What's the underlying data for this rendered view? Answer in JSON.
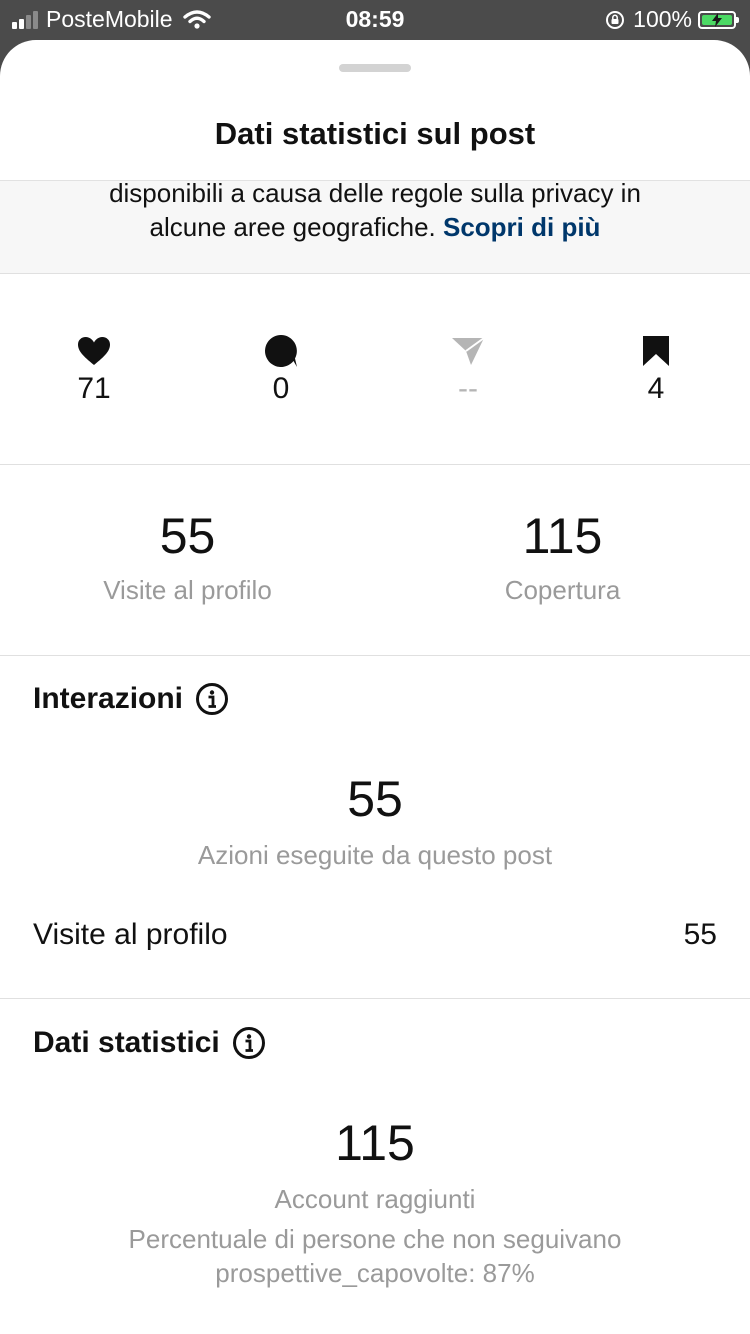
{
  "status_bar": {
    "carrier": "PosteMobile",
    "time": "08:59",
    "battery": "100%"
  },
  "sheet": {
    "title": "Dati statistici sul post",
    "privacy_line1": "disponibili a causa delle regole sulla privacy in",
    "privacy_line2": "alcune aree geografiche.",
    "privacy_link": "Scopri di più"
  },
  "engagement": {
    "likes": "71",
    "comments": "0",
    "shares": "--",
    "saves": "4",
    "icons": [
      "heart-icon",
      "comment-icon",
      "send-icon",
      "bookmark-icon"
    ]
  },
  "summary": {
    "profile_visits_value": "55",
    "profile_visits_label": "Visite al profilo",
    "reach_value": "115",
    "reach_label": "Copertura"
  },
  "interactions": {
    "title": "Interazioni",
    "total": "55",
    "total_label": "Azioni eseguite da questo post",
    "row_label": "Visite al profilo",
    "row_value": "55"
  },
  "insights": {
    "title": "Dati statistici",
    "total": "115",
    "total_label": "Account raggiunti",
    "note_line1": "Percentuale di persone che non seguivano",
    "note_line2": "prospettive_capovolte: 87%"
  },
  "colors": {
    "link": "#00376b",
    "battery_fill": "#4cd964",
    "muted_text": "#9a9a9a"
  }
}
